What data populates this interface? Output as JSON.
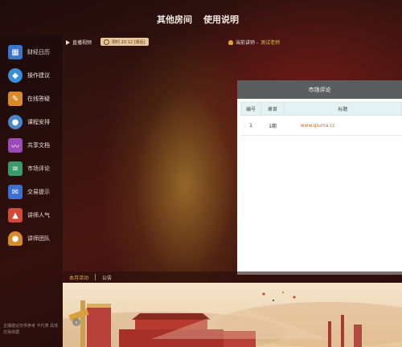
{
  "header": {
    "menu": [
      "其他房间",
      "使用说明"
    ]
  },
  "sidebar": {
    "items": [
      {
        "label": "财经日历",
        "icon": "calendar-icon",
        "color": "#3d74c8"
      },
      {
        "label": "操作建议",
        "icon": "bell-icon",
        "color": "#3b8fd6"
      },
      {
        "label": "在线答疑",
        "icon": "document-icon",
        "color": "#d9892a"
      },
      {
        "label": "课程安排",
        "icon": "teacher-icon",
        "color": "#4a86c8"
      },
      {
        "label": "共享文档",
        "icon": "chart-icon",
        "color": "#9b4bb8"
      },
      {
        "label": "市场评论",
        "icon": "books-icon",
        "color": "#3b9a6a"
      },
      {
        "label": "交易提示",
        "icon": "mail-icon",
        "color": "#3d6fd0"
      },
      {
        "label": "讲师人气",
        "icon": "thumbs-up-icon",
        "color": "#d04a3a"
      },
      {
        "label": "讲师团队",
        "icon": "user-icon",
        "color": "#d8892a"
      }
    ],
    "footer": "主播建议仅供参考 不代表 具体交易依据"
  },
  "live": {
    "label": "直播视频",
    "time": "限时 20:12 [课后]"
  },
  "teacher": {
    "prefix": "当前讲师 -",
    "name": "测试老师"
  },
  "panel": {
    "title": "市场评论",
    "columns": [
      "编号",
      "章首",
      "标题"
    ],
    "rows": [
      {
        "id": "1",
        "chapter": "1期",
        "title": "www.qiuma.cc"
      }
    ]
  },
  "bottom_tabs": [
    "本月活动",
    "公告"
  ],
  "colors": {
    "accent": "#e6b04a",
    "panel_header": "#5b5d5f",
    "table_header": "#e4f2f4",
    "link": "#c86a2a"
  }
}
